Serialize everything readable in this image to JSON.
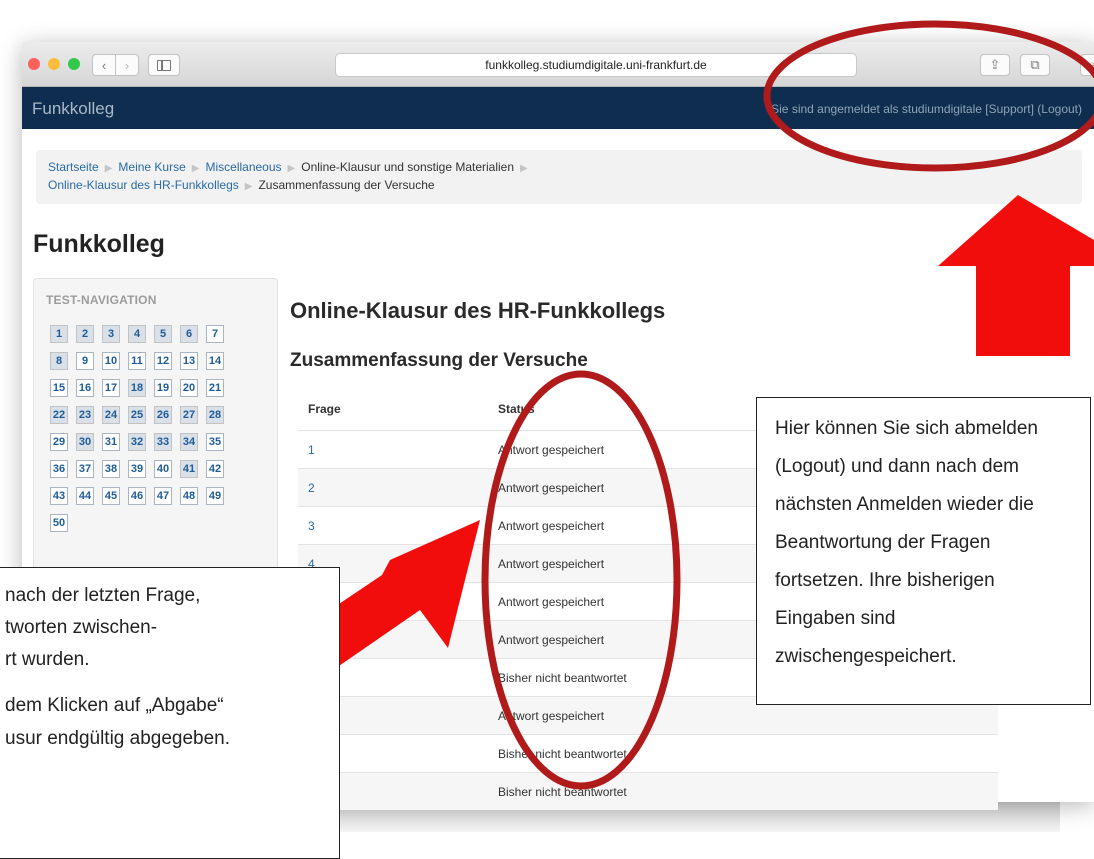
{
  "browser": {
    "url": "funkkolleg.studiumdigitale.uni-frankfurt.de",
    "back_icon": "chevron-left-icon",
    "forward_icon": "chevron-right-icon",
    "back_glyph": "‹",
    "forward_glyph": "›",
    "share_glyph": "⇪",
    "tabs_glyph": "⧉",
    "plus_glyph": "+"
  },
  "header": {
    "brand": "Funkkolleg",
    "login_text": "Sie sind angemeldet als studiumdigitale [Support] (Logout)"
  },
  "breadcrumb": {
    "items": [
      "Startseite",
      "Meine Kurse",
      "Miscellaneous",
      "Online-Klausur und sonstige Materialien",
      "Online-Klausur des HR-Funkkollegs",
      "Zusammenfassung der Versuche"
    ],
    "separator": "▶"
  },
  "page": {
    "title": "Funkkolleg",
    "quiz_title": "Online-Klausur des HR-Funkkollegs",
    "summary_title": "Zusammenfassung der Versuche"
  },
  "navigation": {
    "heading": "TEST-NAVIGATION",
    "questions": [
      "1",
      "2",
      "3",
      "4",
      "5",
      "6",
      "7",
      "8",
      "9",
      "10",
      "11",
      "12",
      "13",
      "14",
      "15",
      "16",
      "17",
      "18",
      "19",
      "20",
      "21",
      "22",
      "23",
      "24",
      "25",
      "26",
      "27",
      "28",
      "29",
      "30",
      "31",
      "32",
      "33",
      "34",
      "35",
      "36",
      "37",
      "38",
      "39",
      "40",
      "41",
      "42",
      "43",
      "44",
      "45",
      "46",
      "47",
      "48",
      "49",
      "50"
    ],
    "answered": [
      "1",
      "2",
      "3",
      "4",
      "5",
      "6",
      "8",
      "18",
      "22",
      "23",
      "24",
      "25",
      "26",
      "27",
      "28",
      "30",
      "32",
      "33",
      "34",
      "41"
    ]
  },
  "table": {
    "headers": {
      "question": "Frage",
      "status": "Status"
    },
    "rows": [
      {
        "question": "1",
        "status": "Antwort gespeichert"
      },
      {
        "question": "2",
        "status": "Antwort gespeichert"
      },
      {
        "question": "3",
        "status": "Antwort gespeichert"
      },
      {
        "question": "4",
        "status": "Antwort gespeichert"
      },
      {
        "question": "",
        "status": "Antwort gespeichert"
      },
      {
        "question": "",
        "status": "Antwort gespeichert"
      },
      {
        "question": "",
        "status": "Bisher nicht beantwortet"
      },
      {
        "question": "",
        "status": "Antwort gespeichert"
      },
      {
        "question": "",
        "status": "Bisher nicht beantwortet"
      },
      {
        "question": "",
        "status": "Bisher nicht beantwortet"
      }
    ]
  },
  "annotations": {
    "left_lines": [
      "nach der letzten Frage,",
      "tworten zwischen-",
      "rt wurden.",
      "dem Klicken auf „Abgabe“",
      "usur endgültig abgegeben."
    ],
    "right_text": "Hier können Sie sich abmelden (Logout) und dann nach dem nächsten Anmelden wieder die Beantwortung der Fragen fortsetzen. Ihre bisherigen Eingaben sind zwischengespeichert.",
    "arrow_color": "#f20d0d",
    "ellipse_color": "#b01a1a"
  }
}
